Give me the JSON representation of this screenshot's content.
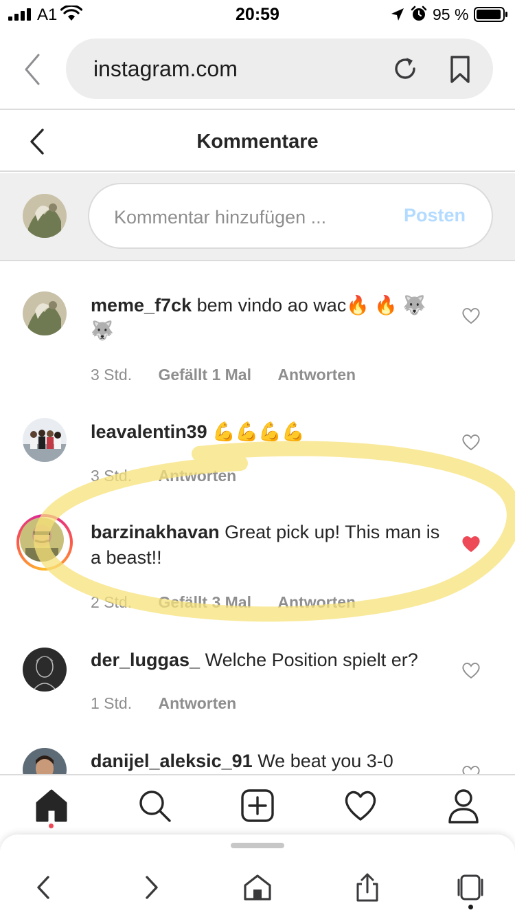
{
  "status_bar": {
    "carrier": "A1",
    "time": "20:59",
    "battery_percent": "95 %",
    "battery_level": 0.95
  },
  "browser": {
    "url": "instagram.com"
  },
  "header": {
    "title": "Kommentare"
  },
  "add_comment": {
    "placeholder": "Kommentar hinzufügen ...",
    "post_label": "Posten"
  },
  "comments": [
    {
      "username": "meme_f7ck",
      "text": "bem vindo ao wac🔥 🔥 🐺 🐺",
      "time": "3 Std.",
      "likes": "Gefällt 1 Mal",
      "reply": "Antworten",
      "liked": false
    },
    {
      "username": "leavalentin39",
      "text": "💪💪💪💪",
      "time": "3 Std.",
      "likes": "",
      "reply": "Antworten",
      "liked": false
    },
    {
      "username": "barzinakhavan",
      "text": "Great pick up! This man is a beast!!",
      "time": "2 Std.",
      "likes": "Gefällt 3 Mal",
      "reply": "Antworten",
      "liked": true
    },
    {
      "username": "der_luggas_",
      "text": "Welche Position spielt er?",
      "time": "1 Std.",
      "likes": "",
      "reply": "Antworten",
      "liked": false
    },
    {
      "username": "danijel_aleksic_91",
      "text": "We beat you 3-0",
      "time": "",
      "likes": "",
      "reply": "",
      "liked": false
    }
  ],
  "tab_bar": {
    "icons": [
      "home-icon",
      "search-icon",
      "new-post-icon",
      "activity-heart-icon",
      "profile-icon"
    ]
  },
  "safari_toolbar": {
    "icons": [
      "back-icon",
      "forward-icon",
      "home-icon",
      "share-icon",
      "tabs-icon"
    ]
  },
  "colors": {
    "liked_heart": "#ed4956",
    "post_button_disabled": "#b3dbff",
    "highlight_marker": "#f7e27a"
  }
}
